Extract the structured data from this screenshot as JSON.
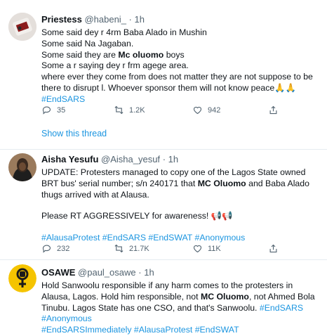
{
  "tweets": [
    {
      "name": "Priestess",
      "handle": "@habeni_",
      "sep": "·",
      "time": "1h",
      "lines": [
        "Some said dey r 4rm Baba Alado in Mushin",
        "Some said Na Jagaban.",
        "Some said they are ",
        "Mc oluomo",
        " boys",
        "Some a r saying dey r frm agege area.",
        "where ever they come from does not matter they are not suppose to be there to disrupt l. Whoever sponsor them will not know peace",
        "🙏🙏",
        "#EndSARS"
      ],
      "replies": "35",
      "retweets": "1.2K",
      "likes": "942",
      "show_thread": "Show this thread"
    },
    {
      "name": "Aisha Yesufu",
      "handle": "@Aisha_yesuf",
      "sep": "·",
      "time": "1h",
      "p1a": "UPDATE: Protesters managed to copy one of the Lagos State owned BRT bus' serial number; s/n 240171 that ",
      "p1b": "MC Oluomo",
      "p1c": " and Baba Alado thugs arrived with at Alausa.",
      "p2": "Please RT AGGRESSIVELY for awareness! ",
      "p2_emoji": "📢📢",
      "tags": "#AlausaProtest #EndSARS #EndSWAT #Anonymous",
      "replies": "232",
      "retweets": "21.7K",
      "likes": "11K"
    },
    {
      "name": "OSAWE",
      "handle": "@paul_osawe",
      "sep": "·",
      "time": "1h",
      "t1": "Hold Sanwoolu responsible if any harm comes to the protesters in Alausa, Lagos. Hold him responsible, not ",
      "t2": "MC Oluomo",
      "t3": ", not Ahmed Bola Tinubu. Lagos State has one CSO, and that's Sanwoolu. ",
      "tags1": "#EndSARS #Anonymous",
      "tags2": "#EndSARSImmediately #AlausaProtest #EndSWAT"
    }
  ],
  "icons": {
    "reply": "reply-icon",
    "retweet": "retweet-icon",
    "like": "heart-icon",
    "share": "share-icon"
  },
  "colors": {
    "link": "#1b95e0",
    "muted": "#536471",
    "border": "#e6ecf0",
    "fist_bg": "#f5c400"
  }
}
